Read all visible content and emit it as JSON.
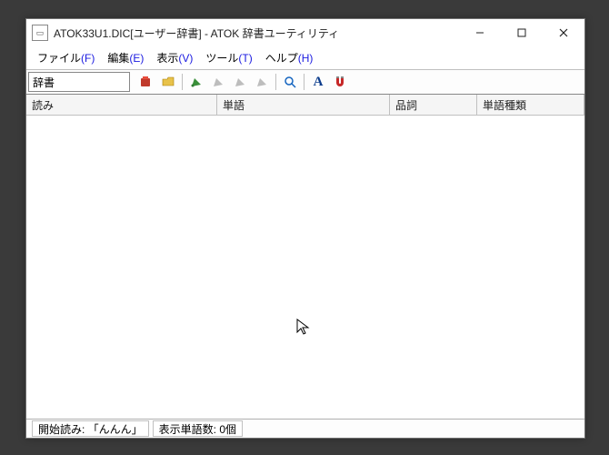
{
  "title": "ATOK33U1.DIC[ユーザー辞書] - ATOK 辞書ユーティリティ",
  "menubar": {
    "file": {
      "label": "ファイル",
      "key": "(F)"
    },
    "edit": {
      "label": "編集",
      "key": "(E)"
    },
    "view": {
      "label": "表示",
      "key": "(V)"
    },
    "tool": {
      "label": "ツール",
      "key": "(T)"
    },
    "help": {
      "label": "ヘルプ",
      "key": "(H)"
    }
  },
  "toolbar": {
    "dict_label": "辞書"
  },
  "columns": {
    "reading": "読み",
    "word": "単語",
    "pos": "品詞",
    "type": "単語種類"
  },
  "statusbar": {
    "start_reading": "開始読み: 「んんん」",
    "word_count": "表示単語数: 0個"
  }
}
